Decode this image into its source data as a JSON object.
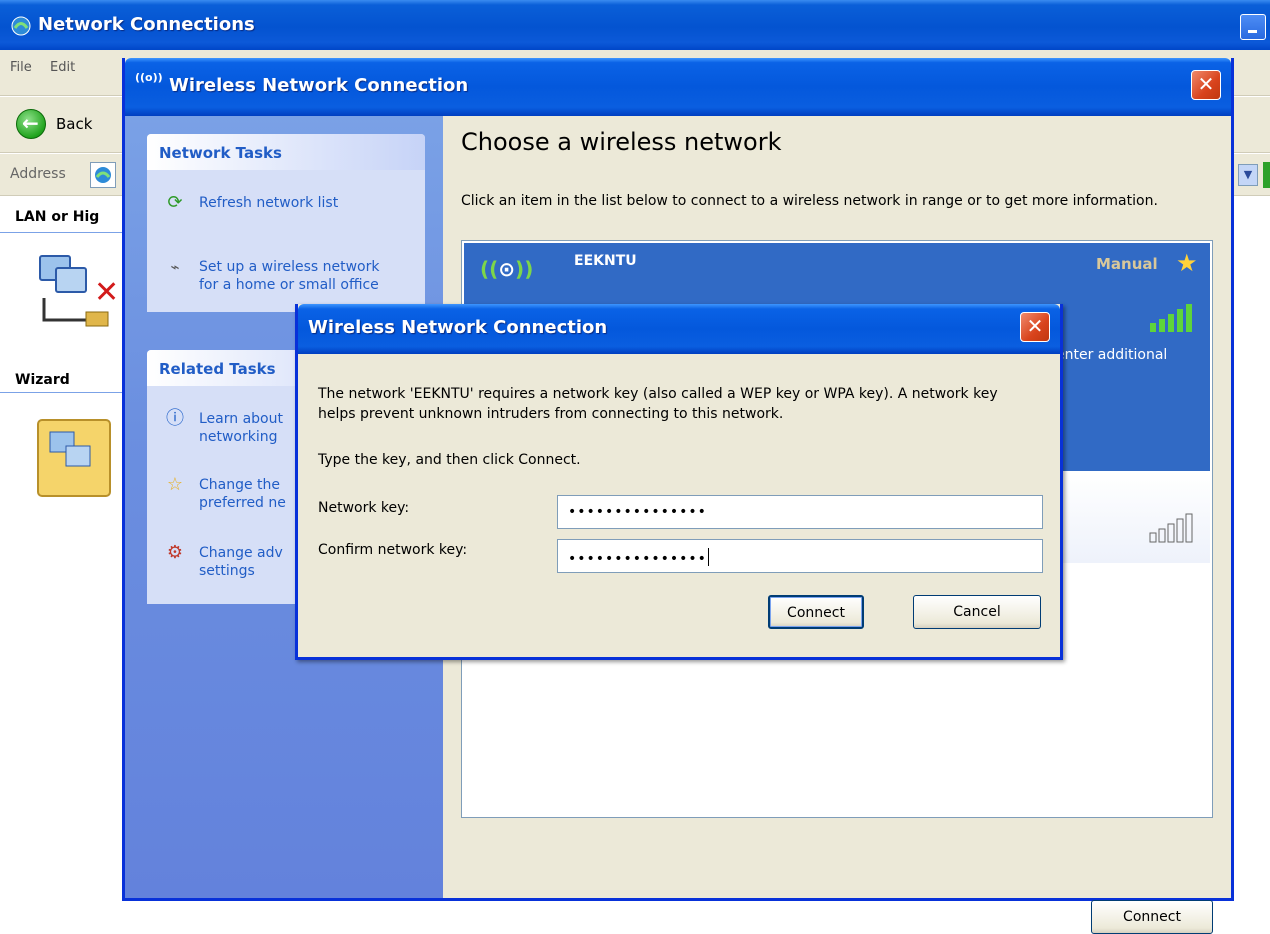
{
  "background_window": {
    "title": "Network Connections",
    "menu": [
      "File",
      "Edit"
    ],
    "toolbar": {
      "back_label": "Back"
    },
    "address_label": "Address",
    "sections": [
      {
        "label": "LAN or Hig"
      },
      {
        "label": "Wizard"
      }
    ]
  },
  "wireless_window": {
    "title": "Wireless Network Connection",
    "title_icon_text": "((o))",
    "sidebar": {
      "network_tasks": {
        "header": "Network Tasks",
        "items": [
          {
            "label": "Refresh network list",
            "icon": "refresh-icon"
          },
          {
            "label": "Set up a wireless network\nfor a home or small office",
            "icon": "wireless-setup-icon"
          }
        ]
      },
      "related_tasks": {
        "header": "Related Tasks",
        "items": [
          {
            "label": "Learn about\nnetworking",
            "icon": "info-icon"
          },
          {
            "label": "Change the\npreferred ne",
            "icon": "star-icon"
          },
          {
            "label": "Change adv\nsettings",
            "icon": "settings-icon"
          }
        ]
      }
    },
    "main": {
      "heading": "Choose a wireless network",
      "instructions": "Click an item in the list below to connect to a wireless network in range or to get more information.",
      "networks": [
        {
          "name": "EEKNTU",
          "type": "Manual",
          "info_partial": "enter additional",
          "selected": true
        },
        {
          "name": "",
          "selected": false
        }
      ],
      "connect_label": "Connect"
    }
  },
  "key_dialog": {
    "title": "Wireless Network Connection",
    "message": "The network 'EEKNTU' requires a network key (also called a WEP key or WPA key). A network key helps prevent unknown intruders from connecting to this network.",
    "instruction": "Type the key, and then click Connect.",
    "network_key_label": "Network key:",
    "network_key_value": "•••••••••••••••",
    "confirm_key_label": "Confirm network key:",
    "confirm_key_value": "•••••••••••••••",
    "connect_label": "Connect",
    "cancel_label": "Cancel"
  },
  "colors": {
    "xp_titlebar_blue": "#0458dc",
    "selection_blue": "#316ac5",
    "sidebar_blue": "#6b8fe0",
    "task_link_blue": "#215dc6",
    "close_red": "#d8431c",
    "dialog_face": "#ece9d8"
  }
}
